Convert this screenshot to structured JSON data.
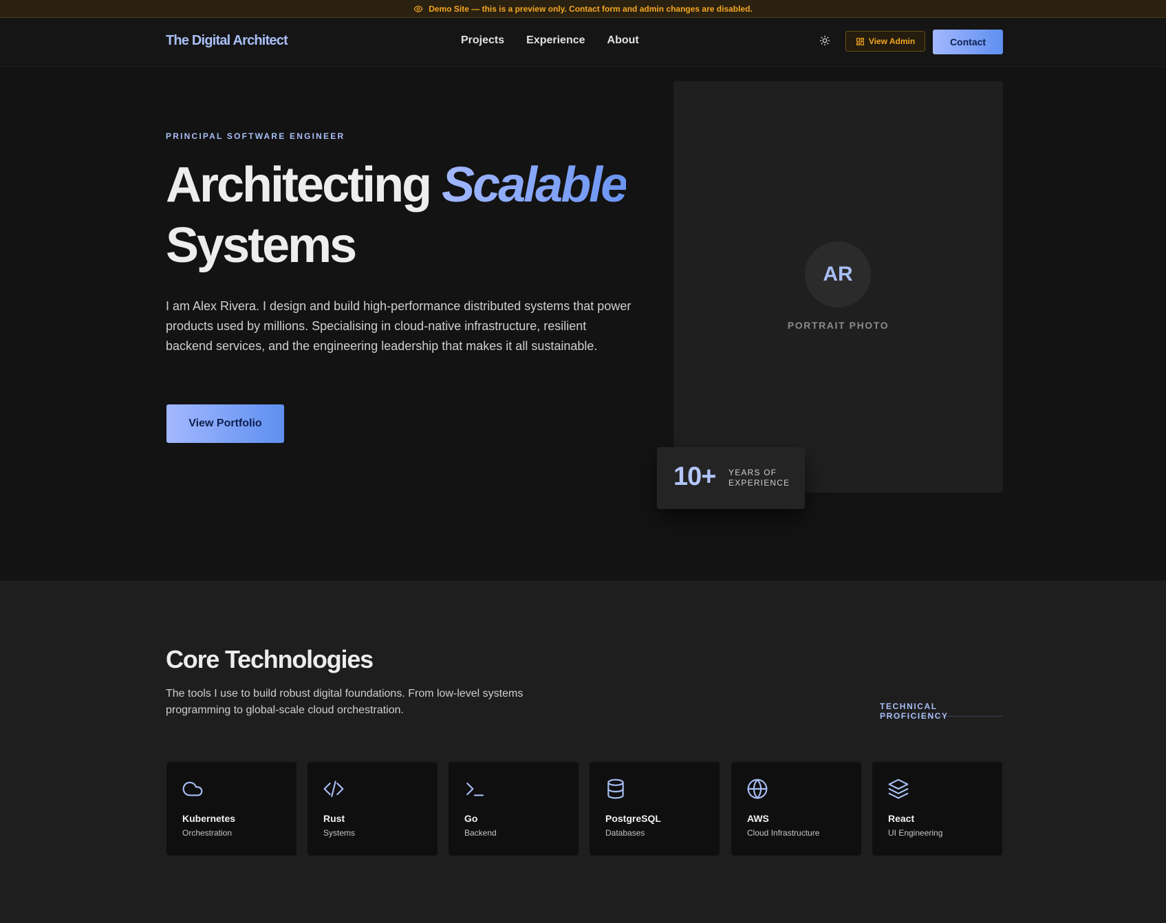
{
  "banner": {
    "icon": "eye-icon",
    "text": "Demo Site — this is a preview only. Contact form and admin changes are disabled."
  },
  "header": {
    "logo": "The Digital Architect",
    "nav": [
      "Projects",
      "Experience",
      "About"
    ],
    "theme_icon": "sun-icon",
    "view_admin_icon": "dashboard-icon",
    "view_admin_label": "View Admin",
    "contact_label": "Contact"
  },
  "hero": {
    "eyebrow": "PRINCIPAL SOFTWARE ENGINEER",
    "title_part1": "Architecting",
    "title_accent": "Scalable",
    "title_part2": "Systems",
    "description": "I am Alex Rivera. I design and build high-performance distributed systems that power products used by millions. Specialising in cloud-native infrastructure, resilient backend services, and the engineering leadership that makes it all sustainable.",
    "cta_label": "View Portfolio",
    "avatar_initials": "AR",
    "portrait_label": "PORTRAIT PHOTO",
    "experience_number": "10+",
    "experience_label": "YEARS OF EXPERIENCE"
  },
  "technologies": {
    "title": "Core Technologies",
    "description": "The tools I use to build robust digital foundations. From low-level systems programming to global-scale cloud orchestration.",
    "proficiency_link": "TECHNICAL PROFICIENCY",
    "items": [
      {
        "name": "Kubernetes",
        "category": "Orchestration",
        "icon": "cloud-icon"
      },
      {
        "name": "Rust",
        "category": "Systems",
        "icon": "code-icon"
      },
      {
        "name": "Go",
        "category": "Backend",
        "icon": "terminal-icon"
      },
      {
        "name": "PostgreSQL",
        "category": "Databases",
        "icon": "database-icon"
      },
      {
        "name": "AWS",
        "category": "Cloud Infrastructure",
        "icon": "globe-icon"
      },
      {
        "name": "React",
        "category": "UI Engineering",
        "icon": "layers-icon"
      }
    ]
  },
  "colors": {
    "accent": "#a9bff7",
    "accent_strong": "#7aa2f7",
    "warning": "#f5a623",
    "background": "#131313",
    "surface": "#1f1f1f"
  }
}
